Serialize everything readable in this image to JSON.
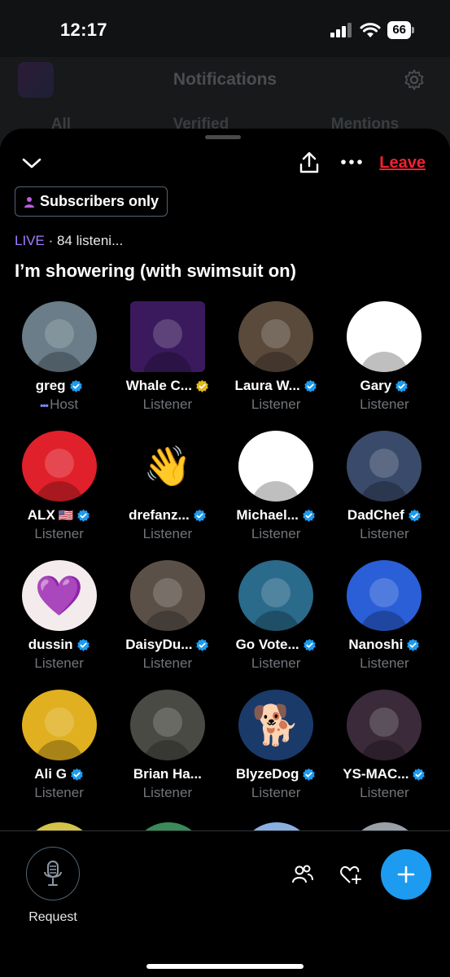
{
  "status_bar": {
    "time": "12:17",
    "battery": "66"
  },
  "background": {
    "title": "Notifications",
    "tabs": [
      "All",
      "Verified",
      "Mentions"
    ]
  },
  "space": {
    "leave_label": "Leave",
    "badge_label": "Subscribers only",
    "live_label": "LIVE",
    "listeners_text": "· 84 listeni...",
    "title": "I’m showering (with swimsuit on)"
  },
  "participants": [
    {
      "name": "greg",
      "role": "Host",
      "verified": "blue",
      "host": true,
      "icon": "photo-young-man-red-hair",
      "bg": "#6a7d88"
    },
    {
      "name": "Whale C...",
      "role": "Listener",
      "verified": "gold",
      "icon": "neon-whale-logo",
      "bg": "#3a1a5c",
      "square": true
    },
    {
      "name": "Laura W...",
      "role": "Listener",
      "verified": "blue",
      "icon": "photo-blonde-woman",
      "bg": "#5a4a3c"
    },
    {
      "name": "Gary",
      "role": "Listener",
      "verified": "blue",
      "icon": "cartoon-giraffe-cap",
      "bg": "#ffffff"
    },
    {
      "name": "ALX",
      "flag": "🇺🇸",
      "role": "Listener",
      "verified": "blue",
      "icon": "photo-man-red-background",
      "bg": "#e0202a"
    },
    {
      "name": "drefanz...",
      "role": "Listener",
      "verified": "blue",
      "icon": "waving-hand-emoji",
      "bg": "#000000",
      "emoji": "👋"
    },
    {
      "name": "Michael...",
      "role": "Listener",
      "verified": "blue",
      "icon": "cartoon-man-glasses",
      "bg": "#ffffff"
    },
    {
      "name": "DadChef",
      "role": "Listener",
      "verified": "blue",
      "icon": "photo-man-supreme-shirt",
      "bg": "#3a4a6a"
    },
    {
      "name": "dussin",
      "role": "Listener",
      "verified": "blue",
      "icon": "purple-heart-cartoon",
      "bg": "#f4ecec",
      "emoji": "💜"
    },
    {
      "name": "DaisyDu...",
      "role": "Listener",
      "verified": "blue",
      "icon": "photo-woman-in-car",
      "bg": "#5b5048"
    },
    {
      "name": "Go Vote...",
      "role": "Listener",
      "verified": "blue",
      "icon": "avatar-blue-face",
      "bg": "#2a6a8a"
    },
    {
      "name": "Nanoshi",
      "role": "Listener",
      "verified": "blue",
      "icon": "anime-boy-sunglasses",
      "bg": "#2a5fd8"
    },
    {
      "name": "Ali G",
      "role": "Listener",
      "verified": "blue",
      "icon": "photo-ali-g-yellow",
      "bg": "#e0b020"
    },
    {
      "name": "Brian Ha...",
      "role": "Listener",
      "verified": "none",
      "icon": "photo-bearded-man",
      "bg": "#4a4a44"
    },
    {
      "name": "BlyzeDog",
      "role": "Listener",
      "verified": "blue",
      "icon": "shiba-dog-hoodie",
      "bg": "#1a3a6a",
      "emoji": "🐕"
    },
    {
      "name": "YS-MAC...",
      "role": "Listener",
      "verified": "blue",
      "icon": "dark-abstract-figure",
      "bg": "#3a2a3a"
    }
  ],
  "bottom": {
    "request_label": "Request"
  },
  "colors": {
    "accent": "#1d9bf0",
    "leave": "#f4212e",
    "live": "#a17cff",
    "gold": "#e2b719"
  }
}
